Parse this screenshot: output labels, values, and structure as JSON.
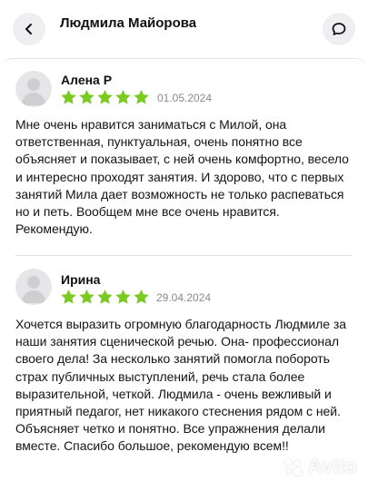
{
  "header": {
    "title": "Людмила Майорова",
    "back_icon": "chevron-left-icon",
    "chat_icon": "chat-bubble-icon"
  },
  "colors": {
    "star": "#7acb1f",
    "date": "#8a8a8f",
    "button_bg": "#efeff1"
  },
  "reviews": [
    {
      "name": "Алена Р",
      "rating": 5,
      "date": "01.05.2024",
      "text": "Мне очень нравится заниматься с Милой, она ответственная, пунктуальная, очень понятно все объясняет и показывает, с ней очень комфортно, весело и интересно проходят занятия. И здорово, что с первых занятий Мила дает возможность не только распеваться но и петь. Вообщем мне все очень нравится. Рекомендую."
    },
    {
      "name": "Ирина",
      "rating": 5,
      "date": "29.04.2024",
      "text": "Хочется выразить огромную благодарность Людмиле за наши занятия сценической речью. Она- профессионал своего дела! За несколько занятий помогла побороть страх публичных выступлений, речь стала более выразительной, четкой. Людмила - очень вежливый и приятный педагог, нет никакого стеснения рядом с ней. Объясняет четко и понятно. Все упражнения делали вместе. Спасибо большое, рекомендую всем!!"
    }
  ],
  "watermark": {
    "text": "Avito"
  }
}
